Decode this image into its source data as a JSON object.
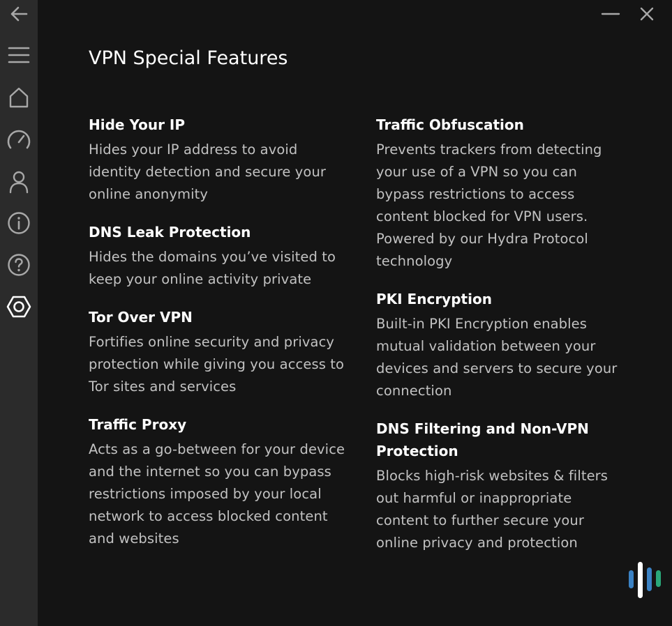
{
  "window": {
    "minimize_icon": "minimize-icon",
    "close_icon": "close-icon"
  },
  "sidebar": {
    "items": [
      {
        "icon": "back-arrow-icon"
      },
      {
        "icon": "hamburger-menu-icon"
      },
      {
        "icon": "home-icon"
      },
      {
        "icon": "speedometer-icon"
      },
      {
        "icon": "user-icon"
      },
      {
        "icon": "info-icon"
      },
      {
        "icon": "help-icon"
      },
      {
        "icon": "settings-hexagon-icon"
      }
    ]
  },
  "page": {
    "title": "VPN Special Features"
  },
  "features_left": [
    {
      "title": "Hide Your IP",
      "description": "Hides your IP address to avoid identity detection and secure your online anonymity"
    },
    {
      "title": "DNS Leak Protection",
      "description": "Hides the domains you’ve visited to keep your online activity private"
    },
    {
      "title": "Tor Over VPN",
      "description": "Fortifies online security and privacy protection while giving you access to Tor sites and services"
    },
    {
      "title": "Traffic Proxy",
      "description": "Acts as a go-between for your device and the internet so you can bypass restrictions imposed by your local network to access blocked content and websites"
    }
  ],
  "features_right": [
    {
      "title": "Traffic Obfuscation",
      "description": "Prevents trackers from detecting your use of a VPN so you can bypass restrictions to access content blocked for VPN users. Powered by our Hydra Protocol technology"
    },
    {
      "title": "PKI Encryption",
      "description": "Built-in PKI Encryption enables mutual validation between your devices and servers to secure your connection"
    },
    {
      "title": "DNS Filtering and Non-VPN Protection",
      "description": "Blocks high-risk websites & filters out harmful or inappropriate content to further secure your online privacy and protection"
    }
  ],
  "colors": {
    "background": "#141414",
    "sidebar": "#2b2b2b",
    "icon": "#a8a8a8",
    "active_icon": "#ffffff",
    "title": "#ffffff",
    "body_text": "#c2c2c2",
    "logo_blue": "#3b82c4",
    "logo_green": "#2aa87a"
  }
}
